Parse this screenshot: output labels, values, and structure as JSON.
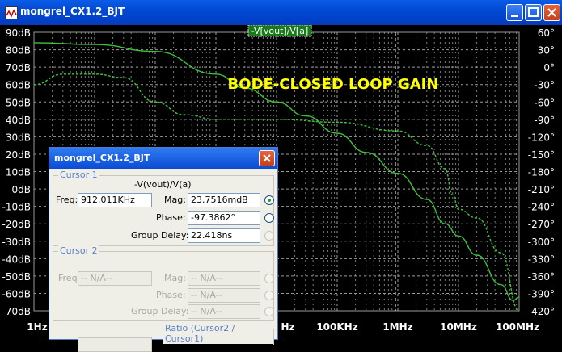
{
  "window": {
    "title": "mongrel_CX1.2_BJT"
  },
  "plot": {
    "trace_label": "-V[vout]/V[a]",
    "annotation": "BODE-CLOSED LOOP GAIN",
    "left_ticks": [
      "90dB",
      "80dB",
      "70dB",
      "60dB",
      "50dB",
      "40dB",
      "30dB",
      "20dB",
      "10dB",
      "0dB",
      "-10dB",
      "-20dB",
      "-30dB",
      "-40dB",
      "-50dB",
      "-60dB",
      "-70dB"
    ],
    "right_ticks": [
      "60°",
      "30°",
      "0°",
      "-30°",
      "-60°",
      "-90°",
      "-120°",
      "-150°",
      "-180°",
      "-210°",
      "-240°",
      "-270°",
      "-300°",
      "-330°",
      "-360°",
      "-390°",
      "-420°"
    ],
    "x_ticks": [
      "1Hz",
      "Hz",
      "100KHz",
      "1MHz",
      "10MHz",
      "100MHz"
    ],
    "colors": {
      "trace": "#3ec23e",
      "grid": "#9a9a9a",
      "cursor": "#ffffff",
      "label_bg": "#1a7a1a",
      "annotation": "#ffff00"
    }
  },
  "chart_data": {
    "type": "line",
    "title": "BODE-CLOSED LOOP GAIN",
    "x_scale": "log",
    "xlim": [
      1,
      100000000
    ],
    "ylim_left": [
      -70,
      90
    ],
    "ylim_right": [
      -420,
      60
    ],
    "series": [
      {
        "name": "-V[vout]/V[a]",
        "axis": "left",
        "style": "solid",
        "x": [
          1,
          10,
          100,
          1000,
          3000,
          10000,
          30000,
          100000,
          300000,
          1000000,
          3000000,
          6000000,
          10000000,
          20000000,
          50000000,
          80000000,
          100000000
        ],
        "values": [
          84,
          83,
          79,
          66,
          58,
          50,
          42,
          32,
          21,
          9,
          -6,
          -20,
          -27,
          -38,
          -55,
          -64,
          -62
        ]
      },
      {
        "name": "-V[vout]/V[a] phase",
        "axis": "right",
        "style": "dashed",
        "x": [
          1,
          3,
          10,
          30,
          100,
          300,
          1000,
          10000,
          100000,
          1000000,
          3000000,
          6000000,
          8000000,
          10000000,
          20000000,
          50000000,
          100000000
        ],
        "values": [
          -30,
          -12,
          -12,
          -18,
          -60,
          -82,
          -90,
          -90,
          -95,
          -110,
          -135,
          -175,
          -220,
          -245,
          -260,
          -320,
          -420
        ]
      }
    ],
    "cursor": {
      "freq": "912.011KHz"
    }
  },
  "dialog": {
    "title": "mongrel_CX1.2_BJT",
    "cursor1": {
      "label": "Cursor 1",
      "trace": "-V(vout)/V(a)",
      "freq_label": "Freq:",
      "freq": "912.011KHz",
      "mag_label": "Mag:",
      "mag": "23.7516mdB",
      "phase_label": "Phase:",
      "phase": "-97.3862°",
      "gd_label": "Group Delay:",
      "gd": "22.418ns"
    },
    "cursor2": {
      "label": "Cursor 2",
      "freq_label": "Freq:",
      "freq": "-- N/A--",
      "mag_label": "Mag:",
      "mag": "-- N/A--",
      "phase_label": "Phase:",
      "phase": "-- N/A--",
      "gd_label": "Group Delay:",
      "gd": "-- N/A--"
    },
    "ratio": {
      "label": "Ratio (Cursor2 / Cursor1)"
    }
  }
}
